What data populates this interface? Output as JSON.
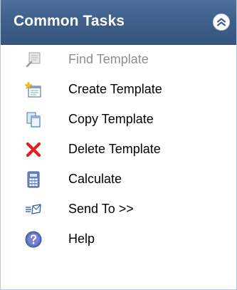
{
  "panel": {
    "title": "Common Tasks",
    "collapse_icon": "double-chevron-up-icon"
  },
  "tasks": [
    {
      "label": "Find Template",
      "icon": "find-template-icon",
      "enabled": false
    },
    {
      "label": "Create Template",
      "icon": "create-template-icon",
      "enabled": true
    },
    {
      "label": "Copy Template",
      "icon": "copy-template-icon",
      "enabled": true
    },
    {
      "label": "Delete Template",
      "icon": "delete-x-icon",
      "enabled": true
    },
    {
      "label": "Calculate",
      "icon": "calculator-icon",
      "enabled": true
    },
    {
      "label": "Send To >>",
      "icon": "send-to-icon",
      "enabled": true
    },
    {
      "label": "Help",
      "icon": "help-icon",
      "enabled": true
    }
  ],
  "colors": {
    "header_bg": "#3e5f8a",
    "header_text": "#ffffff",
    "disabled_text": "#8e8e8e",
    "delete_red": "#e0201a"
  }
}
